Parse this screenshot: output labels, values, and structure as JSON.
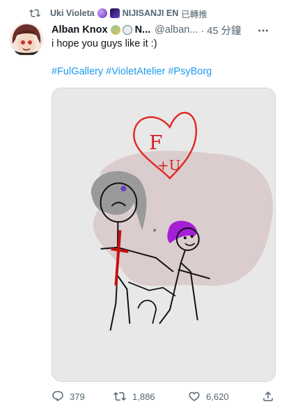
{
  "retweet": {
    "user": "Uki Violeta",
    "org": "NIJISANJI EN",
    "suffix": "已轉推",
    "icon": "retweet-icon"
  },
  "tweet": {
    "author_name": "Alban Knox",
    "author_name_truncated": "N...",
    "handle": "@alban...",
    "time": "· 45 分鐘",
    "text": "i hope you guys like it :)",
    "hashtags": "#FulGallery #VioletAtelier #PsyBorg",
    "drawing_text_1": "F",
    "drawing_text_2": "+U"
  },
  "actions": {
    "reply_count": "379",
    "retweet_count": "1,886",
    "like_count": "6,620",
    "icons": [
      "reply-icon",
      "retweet-icon",
      "heart-icon",
      "share-icon"
    ]
  },
  "colors": {
    "link": "#1d9bf0",
    "muted": "#536471",
    "text": "#0f1419"
  }
}
